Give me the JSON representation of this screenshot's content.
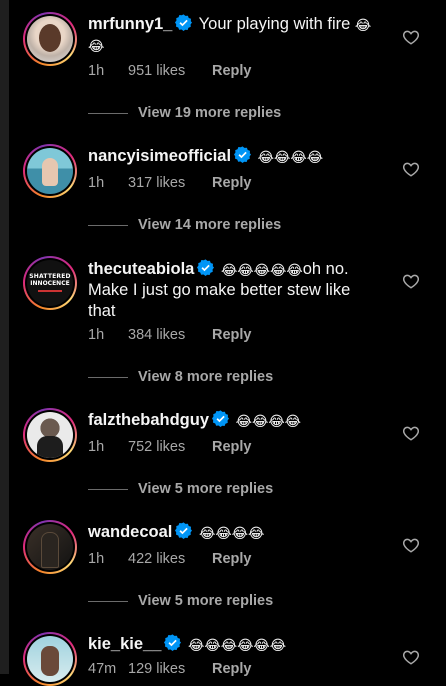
{
  "comments": [
    {
      "username": "mrfunny1_",
      "text": "Your playing with fire",
      "emoji": "😂",
      "time": "1h",
      "likes": "951 likes",
      "reply": "Reply",
      "more_replies": "View 19 more replies"
    },
    {
      "username": "nancyisimeofficial",
      "text": "",
      "emoji": "😂😂😂😂",
      "time": "1h",
      "likes": "317 likes",
      "reply": "Reply",
      "more_replies": "View 14 more replies"
    },
    {
      "username": "thecuteabiola",
      "emoji": "😂😂😂😂😂",
      "text_after_emoji": "oh no.",
      "text_line2": "Make I just go make better stew like",
      "text_line3": "that",
      "time": "1h",
      "likes": "384 likes",
      "reply": "Reply",
      "more_replies": "View 8 more replies",
      "avatar_text_1": "SHATTERED",
      "avatar_text_2": "INNOCENCE"
    },
    {
      "username": "falzthebahdguy",
      "text": "",
      "emoji": "😂😂😂😂",
      "time": "1h",
      "likes": "752 likes",
      "reply": "Reply",
      "more_replies": "View 5 more replies"
    },
    {
      "username": "wandecoal",
      "text": "",
      "emoji": "😂😂😂😂",
      "time": "1h",
      "likes": "422 likes",
      "reply": "Reply",
      "more_replies": "View 5 more replies"
    },
    {
      "username": "kie_kie__",
      "text": "",
      "emoji": "😂😂😂😂😂😂",
      "time": "47m",
      "likes": "129 likes",
      "reply": "Reply"
    }
  ],
  "icons": {
    "verified": "verified-badge-icon",
    "like": "heart-outline-icon"
  },
  "colors": {
    "verified": "#0095f6",
    "text": "#f5f5f5",
    "secondary": "#a8a8a8",
    "background": "#000000"
  }
}
